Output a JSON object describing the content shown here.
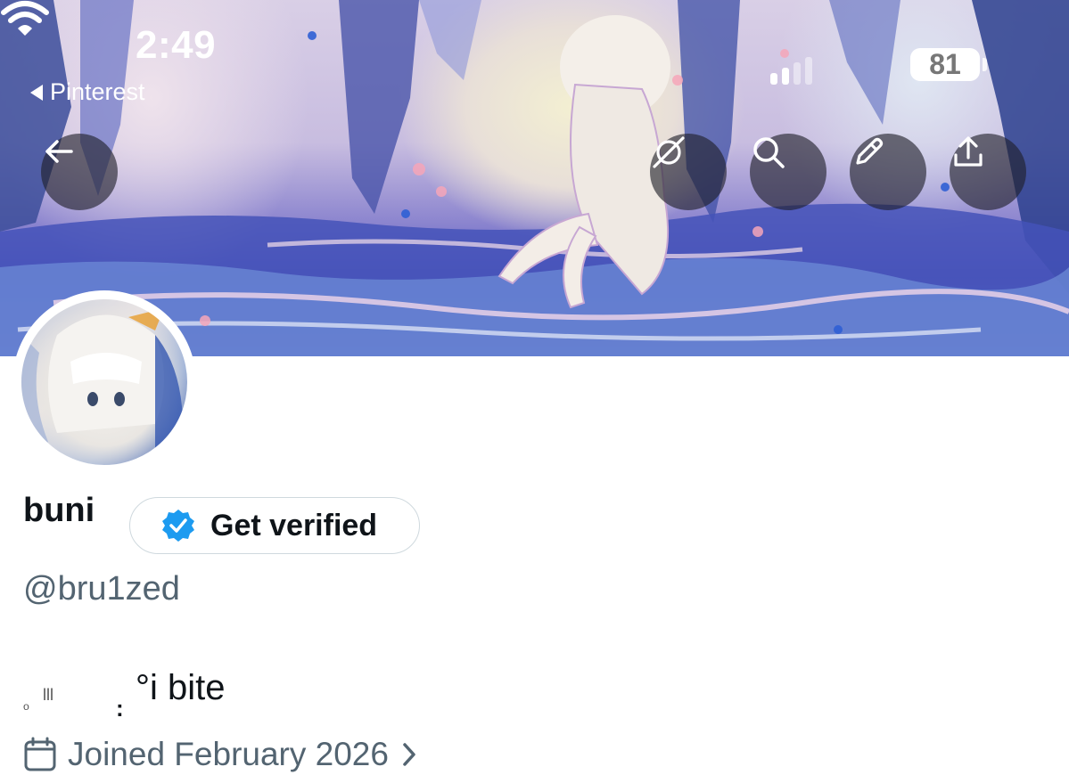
{
  "status_bar": {
    "time": "2:49",
    "back_app": "Pinterest",
    "battery": "81"
  },
  "header": {
    "icons": [
      "back-arrow-icon",
      "grok-icon",
      "search-icon",
      "edit-icon",
      "share-icon"
    ]
  },
  "profile": {
    "name": "buni",
    "verify_label": "Get verified",
    "handle": "@bru1zed",
    "bio_part1": "ₒ",
    "bio_part2": "lll",
    "bio_part3": ":",
    "bio_part4": "°i bite",
    "joined": "Joined February 2026",
    "accent_color": "#1d9bf0"
  }
}
